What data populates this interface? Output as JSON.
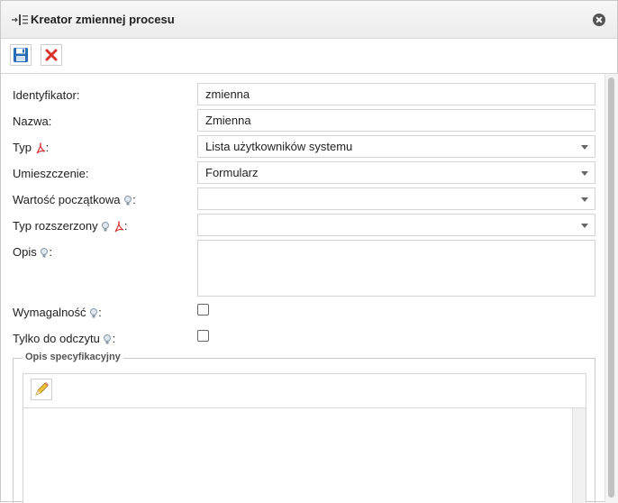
{
  "dialog": {
    "title": "Kreator zmiennej procesu",
    "title_icon": "variable-wizard-icon",
    "close_icon": "close-circle-icon"
  },
  "toolbar": {
    "save_icon": "floppy-save-icon",
    "delete_icon": "red-x-delete-icon"
  },
  "form": {
    "identifier": {
      "label": "Identyfikator:",
      "value": "zmienna"
    },
    "name": {
      "label": "Nazwa:",
      "value": "Zmienna"
    },
    "type": {
      "label": "Typ",
      "suffix": ":",
      "value": "Lista użytkowników systemu",
      "icon": "pdf-icon"
    },
    "placement": {
      "label": "Umieszczenie:",
      "value": "Formularz"
    },
    "initial_value": {
      "label": "Wartość początkowa",
      "suffix": ":",
      "value": "",
      "icon": "hint-bulb-icon"
    },
    "extended_type": {
      "label": "Typ rozszerzony",
      "suffix": ":",
      "value": "",
      "icons": [
        "hint-bulb-icon",
        "pdf-icon"
      ]
    },
    "description": {
      "label": "Opis",
      "suffix": ":",
      "value": "",
      "icon": "hint-bulb-icon"
    },
    "required": {
      "label": "Wymagalność",
      "suffix": ":",
      "checked": false,
      "icon": "hint-bulb-icon"
    },
    "read_only": {
      "label": "Tylko do odczytu",
      "suffix": ":",
      "checked": false,
      "icon": "hint-bulb-icon"
    }
  },
  "spec": {
    "legend": "Opis specyfikacyjny",
    "edit_icon": "pencil-icon",
    "content": ""
  },
  "colors": {
    "accent_blue": "#2a6db5",
    "delete_red": "#d9322b",
    "pdf_red": "#d62b2b"
  }
}
